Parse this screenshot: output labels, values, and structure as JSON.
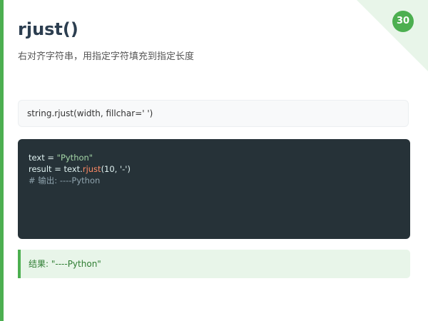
{
  "slide": {
    "number": "30",
    "title": "rjust()",
    "subtitle": "右对齐字符串，用指定字符填充到指定长度"
  },
  "signature": "string.rjust(width, fillchar=' ')",
  "code": {
    "line1": {
      "prefix": "text = ",
      "string": "\"Python\""
    },
    "line2": {
      "prefix": "result = text.",
      "method": "rjust",
      "args": "(10, '-')"
    },
    "line3": {
      "comment": "# 输出: ----Python"
    }
  },
  "result": "结果: \"----Python\"",
  "colors": {
    "accent": "#4caf50",
    "corner": "#e8f5e9",
    "code_bg": "#263238",
    "string_token": "#a5d6a7",
    "method_token": "#ff8a65",
    "comment_token": "#90a4ae",
    "result_text": "#2e7d32"
  }
}
